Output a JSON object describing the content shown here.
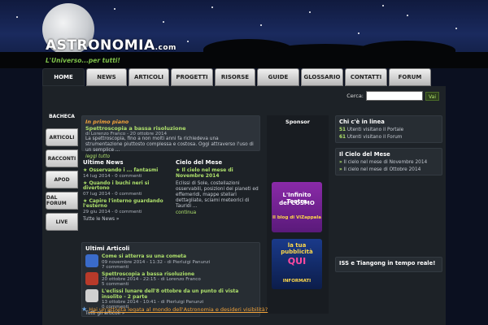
{
  "header": {
    "logo": "ASTRONOMIA",
    "logo_suffix": ".com",
    "tagline": "L'Universo...per tutti!"
  },
  "nav": [
    "HOME",
    "NEWS",
    "ARTICOLI",
    "PROGETTI",
    "RISORSE",
    "GUIDE",
    "GLOSSARIO",
    "CONTATTI",
    "FORUM"
  ],
  "search": {
    "label": "Cerca:",
    "button": "Vai"
  },
  "left_tabs": [
    "BACHECA",
    "ARTICOLI",
    "RACCONTI",
    "APOD",
    "DAL FORUM",
    "LIVE"
  ],
  "primo_piano": {
    "label": "In primo piano",
    "title": "Spettroscopia a bassa risoluzione",
    "meta": "di Lorenzo Franco - 20 ottobre 2014",
    "text": "La spettroscopia, fino a non molti anni fa richiedeva una strumentazione piuttosto complessa e costosa. Oggi attraverso l'uso di un semplice ...",
    "more": "leggi tutto"
  },
  "ultime_news": {
    "title": "Ultime News",
    "items": [
      {
        "title": "Osservando i ... fantasmi",
        "meta": "14 lug 2014 - 0 commenti"
      },
      {
        "title": "Quando i buchi neri si divertono",
        "meta": "07 lug 2014 - 0 commenti"
      },
      {
        "title": "Capire l'interno guardando l'esterno",
        "meta": "29 giu 2014 - 0 commenti"
      }
    ],
    "all": "Tutte le News »"
  },
  "cielo_mese": {
    "title": "Cielo del Mese",
    "item_title": "Il cielo nel mese di Novembre 2014",
    "text": "Eclissi di Sole, costellazioni osservabili, posizioni dei pianeti ed effemeridi, mappe stellari dettagliate, sciami meteorici di Tauridi ...",
    "more": "continua"
  },
  "ultimi_articoli": {
    "title": "Ultimi Articoli",
    "items": [
      {
        "title": "Come si atterra su una cometa",
        "meta": "09 novembre 2014 - 11:32 - di Pierluigi Panunzi",
        "comments": "7 commenti",
        "color": "#3a6bc9"
      },
      {
        "title": "Spettroscopia a bassa risoluzione",
        "meta": "20 ottobre 2014 - 22:15 - di Lorenzo Franco",
        "comments": "5 commenti",
        "color": "#b83a2a"
      },
      {
        "title": "L'eclissi lunare dell'8 ottobre da un punto di vista insolito - 2 parte",
        "meta": "13 ottobre 2014 - 10:41 - di Pierluigi Panunzi",
        "comments": "0 commenti",
        "color": "#d0d0d0"
      }
    ],
    "all": "Tutti gli articoli »"
  },
  "sponsor": {
    "title": "Sponsor",
    "banner1": [
      "L'Infinito Teatro",
      "del COSMO",
      "Il blog di ViZappala"
    ],
    "banner2": [
      "la tua",
      "pubblicità",
      "QUI",
      "INFORMATI"
    ]
  },
  "online": {
    "title": "Chi c'è in linea",
    "rows": [
      {
        "count": "51",
        "text": "Utenti visitano il Portale"
      },
      {
        "count": "61",
        "text": "Utenti visitano il Forum"
      }
    ]
  },
  "cielo_right": {
    "title": "Il Cielo del Mese",
    "rows": [
      "Il cielo nel mese di Novembre 2014",
      "Il cielo nel mese di Ottobre 2014"
    ]
  },
  "iss": {
    "title": "ISS e Tiangong in tempo reale!"
  },
  "bottom_link": "Hai un'attività legata al mondo dell'Astronomia e desideri visibilità?"
}
